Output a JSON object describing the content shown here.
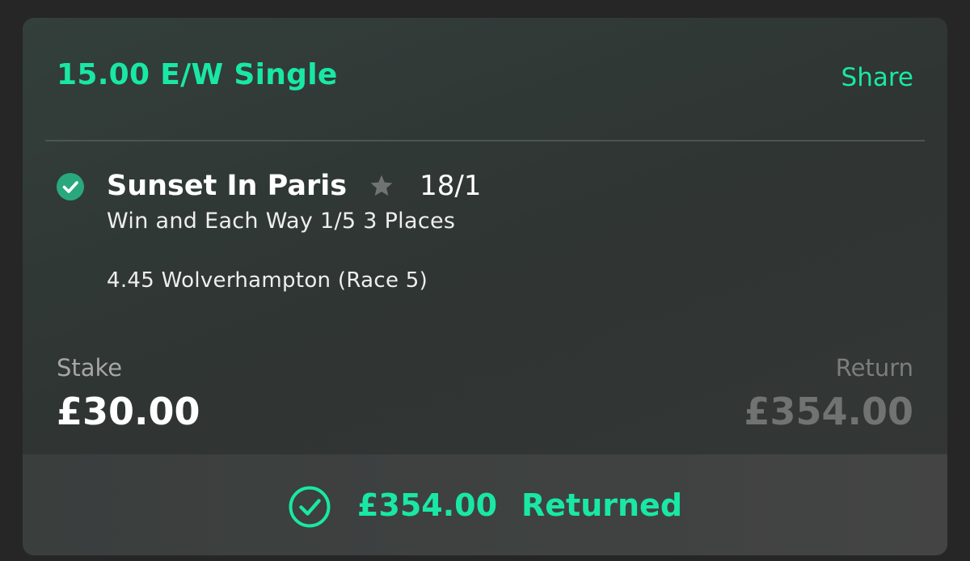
{
  "colors": {
    "accent": "#19e8a4",
    "card_background": "#313836",
    "page_background": "#262626",
    "text_primary": "#ffffff",
    "text_muted": "#a6a6a6",
    "won_badge": "#2aa87d"
  },
  "bet": {
    "title": "15.00 E/W Single",
    "share_label": "Share"
  },
  "selection": {
    "status_icon": "check-circle-filled-icon",
    "name": "Sunset In Paris",
    "favourite_icon": "star-icon",
    "odds": "18/1",
    "market": "Win and Each Way 1/5 3 Places",
    "event": "4.45 Wolverhampton (Race 5)"
  },
  "stake": {
    "label": "Stake",
    "value": "£30.00"
  },
  "return": {
    "label": "Return",
    "value": "£354.00"
  },
  "returned": {
    "icon": "check-circle-outline-icon",
    "amount": "£354.00",
    "label": "Returned"
  }
}
